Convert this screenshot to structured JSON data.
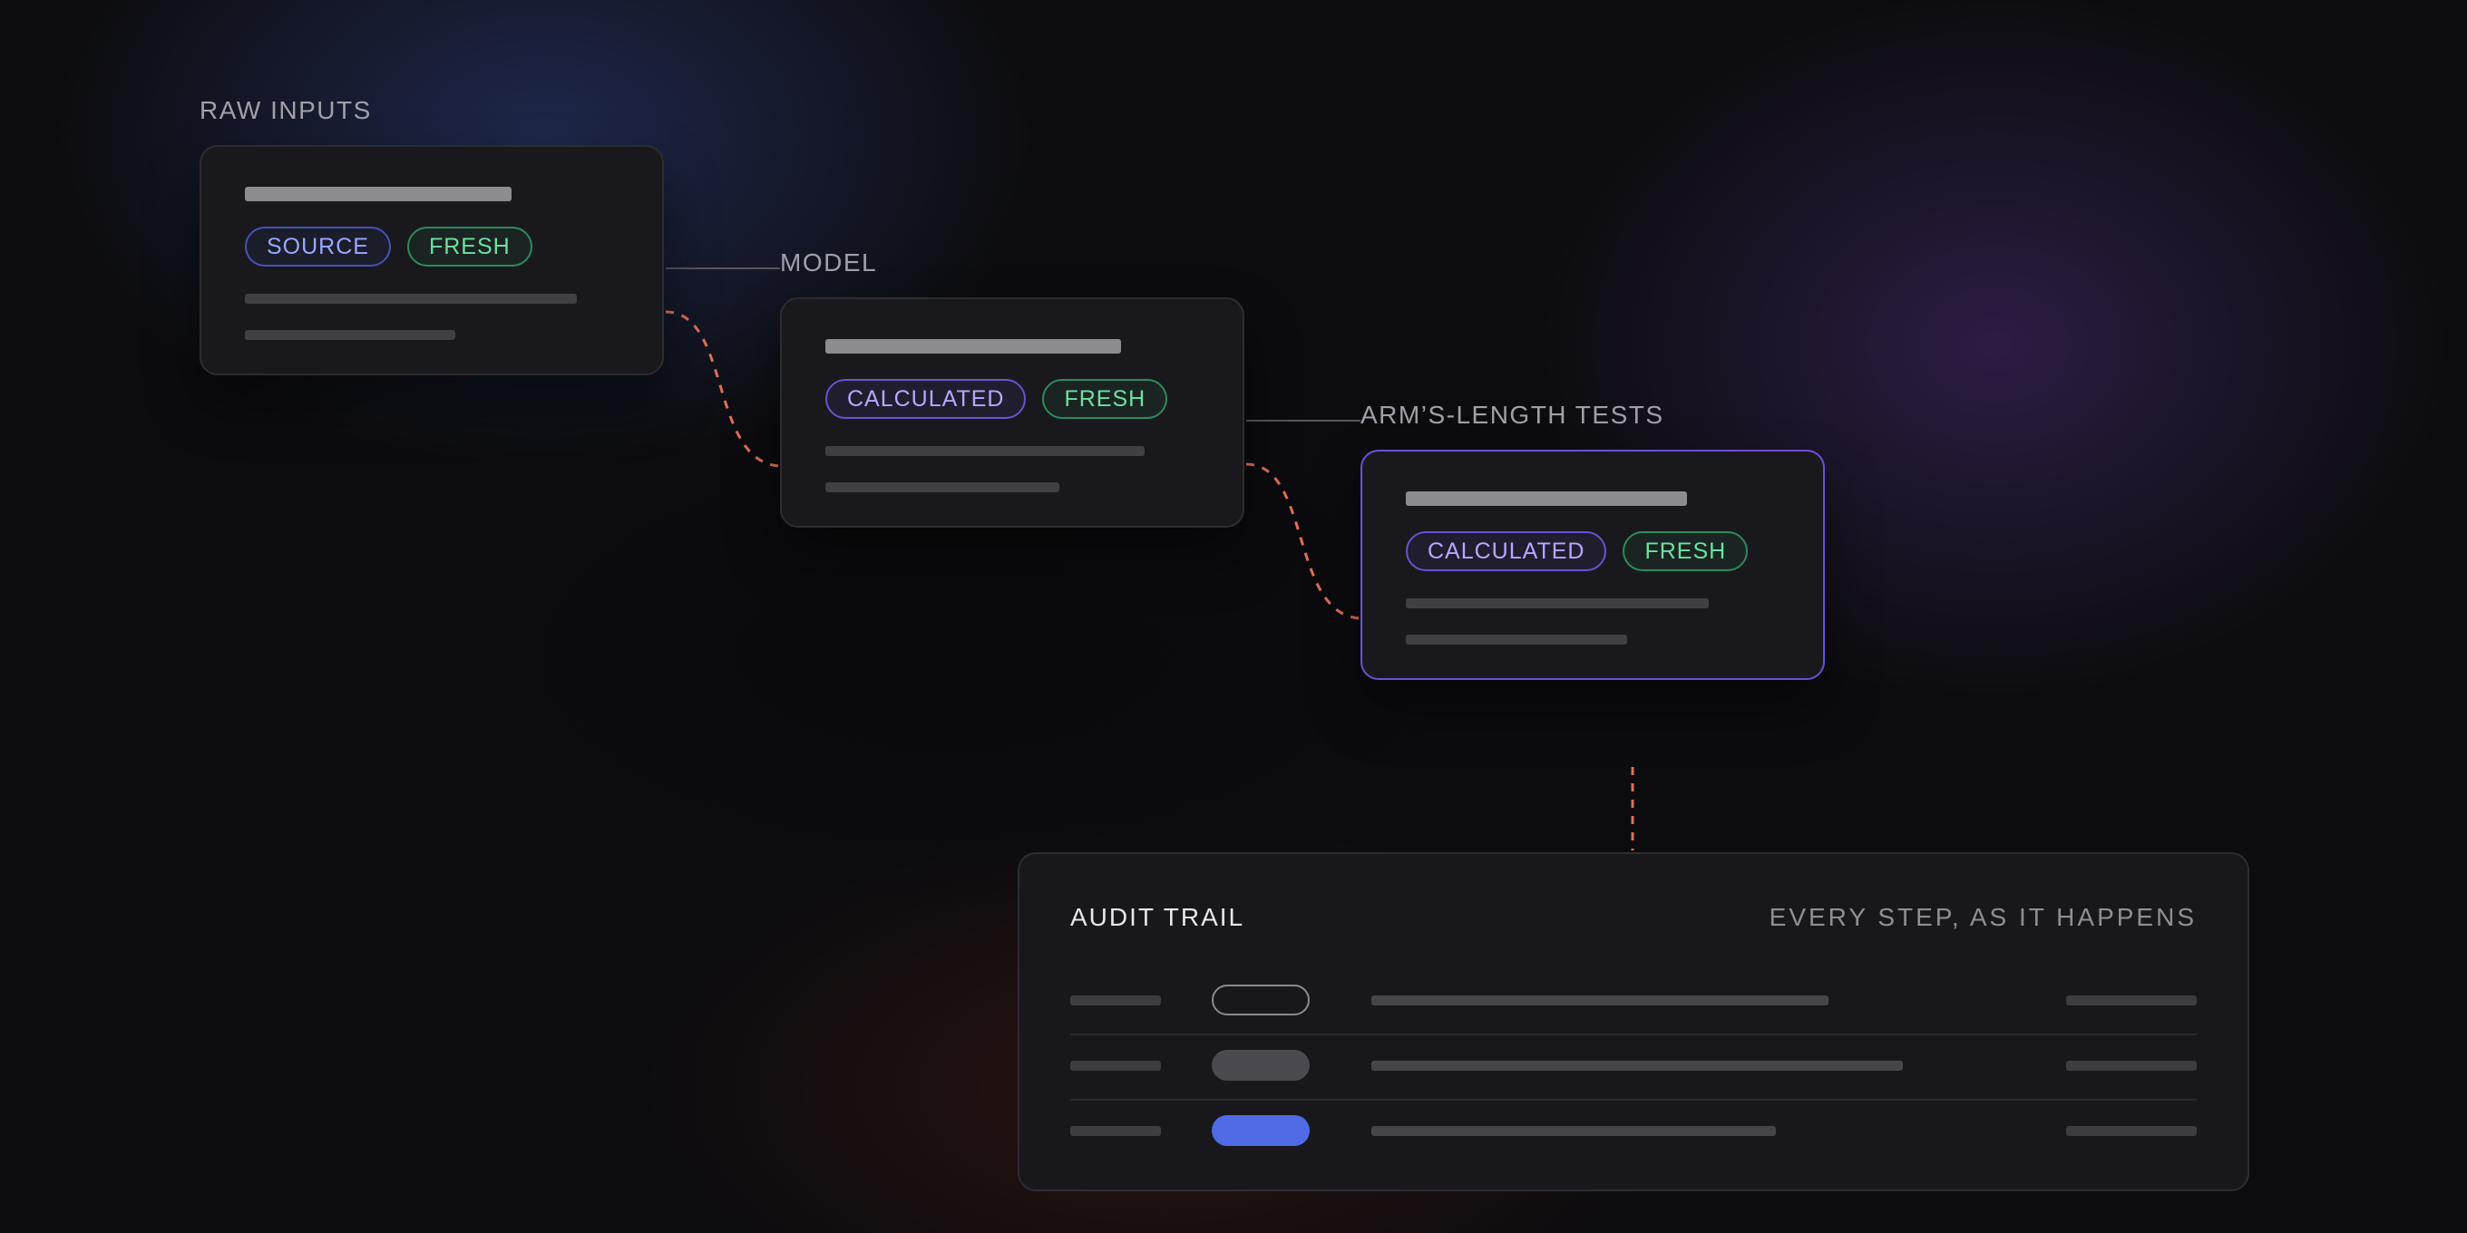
{
  "colors": {
    "background": "#0c0c0f",
    "card": "#19191d",
    "accent_purple": "#6c4fd6",
    "source_blue": "#9aa8ff",
    "fresh_green": "#6ee0a0",
    "connector_dashed": "#e0705a",
    "active_pill": "#4f6ce6"
  },
  "stages": [
    {
      "label": "RAW INPUTS",
      "chips": [
        {
          "label": "SOURCE",
          "kind": "source"
        },
        {
          "label": "FRESH",
          "kind": "fresh"
        }
      ]
    },
    {
      "label": "MODEL",
      "chips": [
        {
          "label": "CALCULATED",
          "kind": "calc"
        },
        {
          "label": "FRESH",
          "kind": "fresh"
        }
      ]
    },
    {
      "label": "ARM’S-LENGTH TESTS",
      "active": true,
      "chips": [
        {
          "label": "CALCULATED",
          "kind": "calc"
        },
        {
          "label": "FRESH",
          "kind": "fresh"
        }
      ]
    }
  ],
  "audit": {
    "title": "AUDIT TRAIL",
    "subtitle": "EVERY STEP, AS IT HAPPENS",
    "rows": [
      {
        "status_style": "outline"
      },
      {
        "status_style": "grey"
      },
      {
        "status_style": "blue"
      }
    ]
  }
}
